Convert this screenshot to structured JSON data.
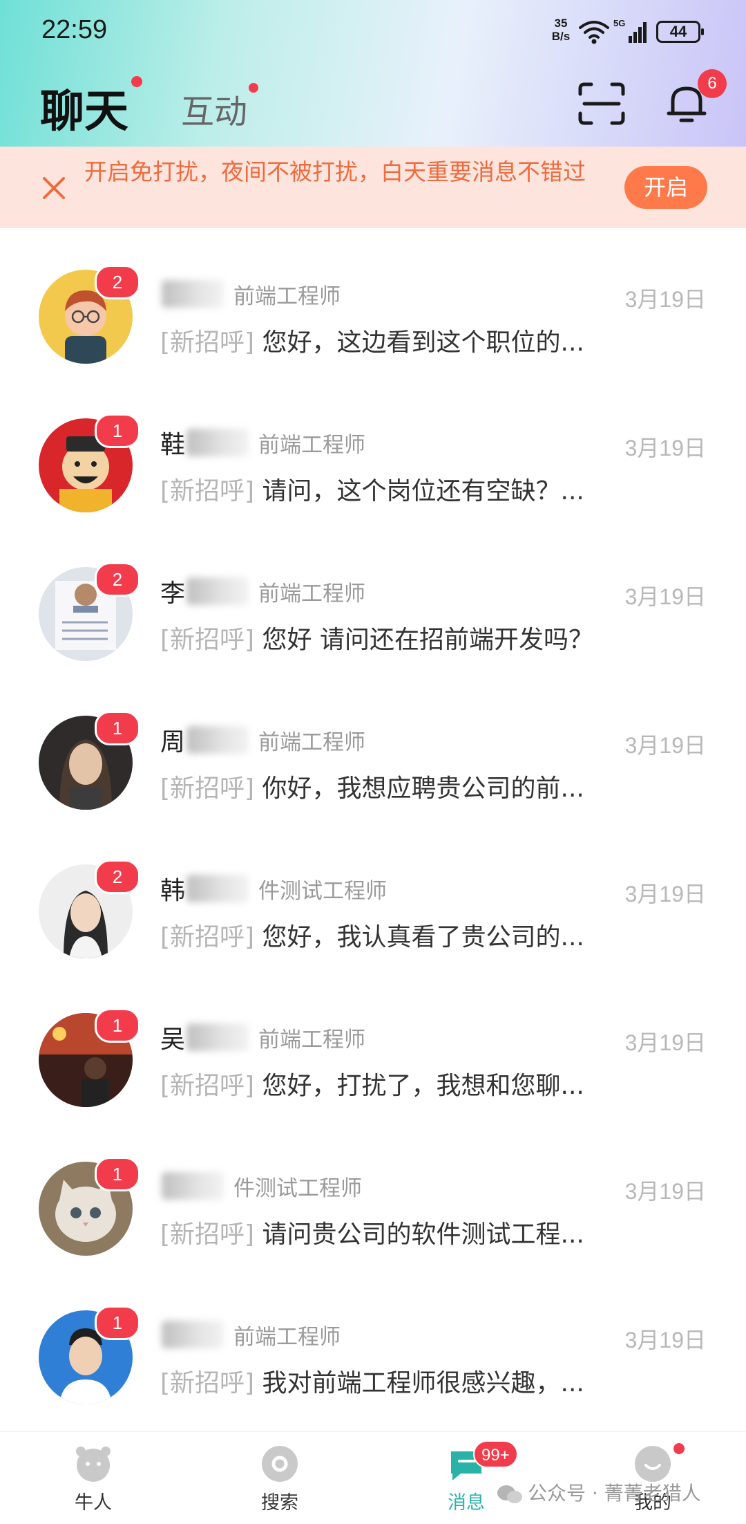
{
  "status_bar": {
    "time": "22:59",
    "net_speed_value": "35",
    "net_speed_unit": "B/s",
    "network_type": "5G",
    "battery": "44"
  },
  "header": {
    "tab_chat": "聊天",
    "tab_interact": "互动",
    "notification_count": "6",
    "icons": [
      "scan-icon",
      "bell-icon"
    ]
  },
  "banner": {
    "text": "开启免打扰，夜间不被打扰，白天重要消息不错过",
    "button": "开启"
  },
  "chats": [
    {
      "name": "",
      "position": "前端工程师",
      "date": "3月19日",
      "tag": "[新招呼]",
      "message": "您好，这边看到这个职位的...",
      "unread": "2"
    },
    {
      "name": "鞋",
      "position": "前端工程师",
      "date": "3月19日",
      "tag": "[新招呼]",
      "message": "请问，这个岗位还有空缺？...",
      "unread": "1"
    },
    {
      "name": "李",
      "position": "前端工程师",
      "date": "3月19日",
      "tag": "[新招呼]",
      "message": "您好 请问还在招前端开发吗？",
      "unread": "2"
    },
    {
      "name": "周",
      "position": "前端工程师",
      "date": "3月19日",
      "tag": "[新招呼]",
      "message": "你好，我想应聘贵公司的前...",
      "unread": "1"
    },
    {
      "name": "韩",
      "position": "件测试工程师",
      "date": "3月19日",
      "tag": "[新招呼]",
      "message": "您好，我认真看了贵公司的...",
      "unread": "2"
    },
    {
      "name": "吴",
      "position": "前端工程师",
      "date": "3月19日",
      "tag": "[新招呼]",
      "message": "您好，打扰了，我想和您聊...",
      "unread": "1"
    },
    {
      "name": "",
      "position": "件测试工程师",
      "date": "3月19日",
      "tag": "[新招呼]",
      "message": "请问贵公司的软件测试工程...",
      "unread": "1"
    },
    {
      "name": "",
      "position": "前端工程师",
      "date": "3月19日",
      "tag": "[新招呼]",
      "message": "我对前端工程师很感兴趣，...",
      "unread": "1"
    }
  ],
  "bottom_nav": {
    "items": [
      {
        "label": "牛人",
        "icon": "cow-face-icon"
      },
      {
        "label": "搜索",
        "icon": "search-disc-icon"
      },
      {
        "label": "消息",
        "icon": "message-icon",
        "badge": "99+"
      },
      {
        "label": "我的",
        "icon": "profile-icon"
      }
    ]
  },
  "watermark": {
    "text": "公众号 · 菁菁老猎人"
  },
  "colors": {
    "accent": "#29b3a8",
    "badge_red": "#f23c4c",
    "banner_bg": "#fde5de",
    "banner_text": "#f06a3e",
    "banner_button": "#ff7a4a"
  }
}
